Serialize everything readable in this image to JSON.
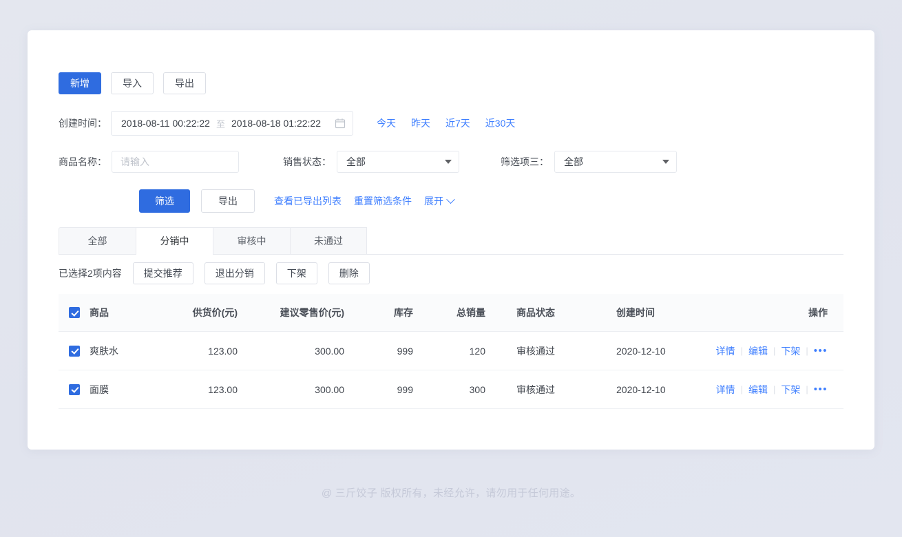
{
  "toolbar": {
    "add_label": "新增",
    "import_label": "导入",
    "export_label": "导出"
  },
  "date_filter": {
    "label": "创建时间：",
    "start_value": "2018-08-11 00:22:22",
    "separator": "至",
    "end_value": "2018-08-18 01:22:22",
    "calendar_icon": "calendar-icon",
    "quick_links": [
      {
        "label": "今天"
      },
      {
        "label": "昨天"
      },
      {
        "label": "近7天"
      },
      {
        "label": "近30天"
      }
    ]
  },
  "filters": {
    "product_name": {
      "label": "商品名称：",
      "placeholder": "请输入",
      "value": ""
    },
    "sale_status": {
      "label": "销售状态：",
      "selected": "全部"
    },
    "filter_three": {
      "label": "筛选项三：",
      "selected": "全部"
    }
  },
  "actions": {
    "filter_button": "筛选",
    "export_button": "导出",
    "links": [
      {
        "label": "查看已导出列表"
      },
      {
        "label": "重置筛选条件"
      }
    ],
    "expand_label": "展开",
    "expand_icon": "chevron-down-icon"
  },
  "tabs": [
    {
      "label": "全部",
      "active": false
    },
    {
      "label": "分销中",
      "active": true
    },
    {
      "label": "审核中",
      "active": false
    },
    {
      "label": "未通过",
      "active": false
    }
  ],
  "selection_bar": {
    "text": "已选择2项内容",
    "buttons": [
      {
        "label": "提交推荐"
      },
      {
        "label": "退出分销"
      },
      {
        "label": "下架"
      },
      {
        "label": "删除"
      }
    ]
  },
  "table": {
    "headers": {
      "product": "商品",
      "supply_price": "供货价(元)",
      "retail_price": "建议零售价(元)",
      "stock": "库存",
      "total_sales": "总销量",
      "status": "商品状态",
      "create_time": "创建时间",
      "operations": "操作"
    },
    "rows": [
      {
        "checked": true,
        "product": "爽肤水",
        "supply_price": "123.00",
        "retail_price": "300.00",
        "stock": "999",
        "total_sales": "120",
        "status": "审核通过",
        "create_time": "2020-12-10",
        "ops": {
          "detail": "详情",
          "edit": "编辑",
          "offshelf": "下架",
          "more": "•••"
        }
      },
      {
        "checked": true,
        "product": "面膜",
        "supply_price": "123.00",
        "retail_price": "300.00",
        "stock": "999",
        "total_sales": "300",
        "status": "审核通过",
        "create_time": "2020-12-10",
        "ops": {
          "detail": "详情",
          "edit": "编辑",
          "offshelf": "下架",
          "more": "•••"
        }
      }
    ]
  },
  "footer": {
    "text": "@ 三斤饺子  版权所有，未经允许，请勿用于任何用途。"
  },
  "colors": {
    "primary": "#2f6ce0",
    "link": "#3d7eff",
    "page_bg": "#e3e6ef",
    "header_bg": "#fafbfc"
  }
}
